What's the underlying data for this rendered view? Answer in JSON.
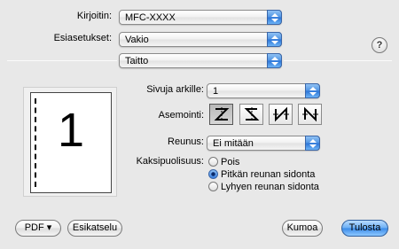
{
  "printer": {
    "label": "Kirjoitin:",
    "value": "MFC-XXXX"
  },
  "presets": {
    "label": "Esiasetukset:",
    "value": "Vakio"
  },
  "help": {
    "glyph": "?"
  },
  "panel": {
    "value": "Taitto"
  },
  "preview": {
    "page_number": "1"
  },
  "pages_per_sheet": {
    "label": "Sivuja arkille:",
    "value": "1"
  },
  "layout_direction": {
    "label": "Asemointi:",
    "options": [
      {
        "icon": "layout-z-icon"
      },
      {
        "icon": "layout-reverse-s-icon"
      },
      {
        "icon": "layout-n-down-icon"
      },
      {
        "icon": "layout-reverse-n-icon"
      }
    ],
    "selected_index": 0
  },
  "border": {
    "label": "Reunus:",
    "value": "Ei mitään"
  },
  "two_sided": {
    "label": "Kaksipuolisuus:",
    "options": [
      "Pois",
      "Pitkän reunan sidonta",
      "Lyhyen reunan sidonta"
    ],
    "selected_index": 1
  },
  "buttons": {
    "pdf": "PDF ▾",
    "preview": "Esikatselu",
    "cancel": "Kumoa",
    "print": "Tulosta"
  }
}
